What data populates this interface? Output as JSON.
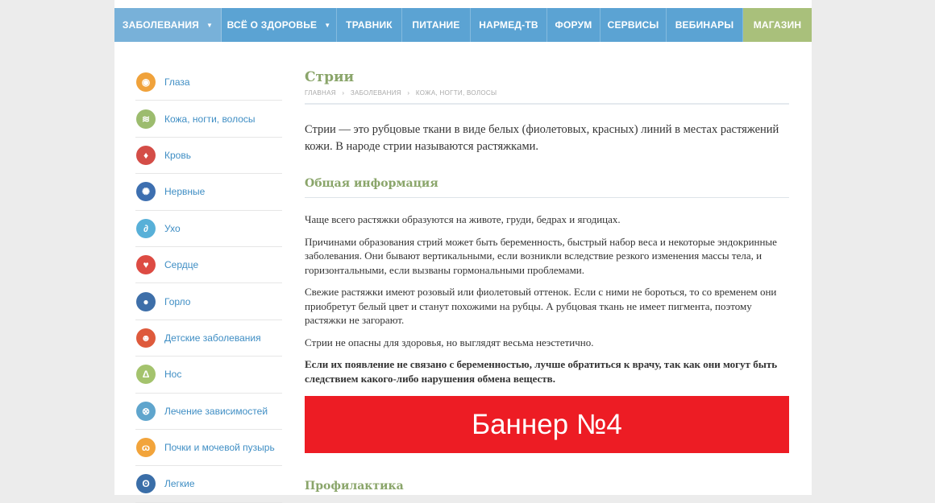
{
  "nav": {
    "items": [
      {
        "label": "ЗАБОЛЕВАНИЯ",
        "caret": "▼"
      },
      {
        "label": "ВСЁ О ЗДОРОВЬЕ",
        "caret": "▼"
      },
      {
        "label": "ТРАВНИК"
      },
      {
        "label": "ПИТАНИЕ"
      },
      {
        "label": "НАРМЕД-ТВ"
      },
      {
        "label": "ФОРУМ"
      },
      {
        "label": "СЕРВИСЫ"
      },
      {
        "label": "ВЕБИНАРЫ"
      },
      {
        "label": "МАГАЗИН"
      }
    ],
    "colors": {
      "bar": "#5ba3d3",
      "active": "#78b1d9",
      "shop": "#a9c07b"
    }
  },
  "sidebar": {
    "items": [
      {
        "label": "Глаза",
        "icon": "eye-icon",
        "color": "#f0a23b",
        "glyph": "◉"
      },
      {
        "label": "Кожа, ногти, волосы",
        "icon": "hair-icon",
        "color": "#9cbc6e",
        "glyph": "≋"
      },
      {
        "label": "Кровь",
        "icon": "blood-drops-icon",
        "color": "#d44d47",
        "glyph": "♦"
      },
      {
        "label": "Нервные",
        "icon": "neuron-icon",
        "color": "#3d6fb0",
        "glyph": "✺"
      },
      {
        "label": "Ухо",
        "icon": "ear-icon",
        "color": "#58b0d8",
        "glyph": "∂"
      },
      {
        "label": "Сердце",
        "icon": "heart-icon",
        "color": "#dd4b43",
        "glyph": "♥"
      },
      {
        "label": "Горло",
        "icon": "throat-icon",
        "color": "#3e6fa9",
        "glyph": "●"
      },
      {
        "label": "Детские заболевания",
        "icon": "child-icon",
        "color": "#de5a3c",
        "glyph": "☻"
      },
      {
        "label": "Нос",
        "icon": "nose-icon",
        "color": "#a4c36d",
        "glyph": "Δ"
      },
      {
        "label": "Лечение зависимостей",
        "icon": "addiction-icon",
        "color": "#5fa5cd",
        "glyph": "⊗"
      },
      {
        "label": "Почки и мочевой пузырь",
        "icon": "kidneys-icon",
        "color": "#f2a43b",
        "glyph": "ɷ"
      },
      {
        "label": "Легкие",
        "icon": "lungs-icon",
        "color": "#3a6ea8",
        "glyph": "ʘ"
      }
    ]
  },
  "article": {
    "title": "Стрии",
    "breadcrumbs": [
      "ГЛАВНАЯ",
      "ЗАБОЛЕВАНИЯ",
      "КОЖА, НОГТИ, ВОЛОСЫ"
    ],
    "breadcrumb_sep": "›",
    "lead": "Стрии — это рубцовые ткани в виде белых (фиолетовых, красных) линий в местах растяжений кожи. В народе стрии называются растяжками.",
    "section1_title": "Общая информация",
    "paragraphs": [
      "Чаще всего растяжки образуются на животе, груди, бедрах и ягодицах.",
      "Причинами образования стрий может быть беременность, быстрый набор веса и некоторые эндокринные заболевания. Они бывают вертикальными, если возникли вследствие резкого изменения массы тела, и горизонтальными, если вызваны гормональными проблемами.",
      "Свежие растяжки имеют розовый или фиолетовый оттенок. Если с ними не бороться, то со временем они приобретут белый цвет и станут похожими на рубцы. А рубцовая ткань не имеет пигмента, поэтому растяжки не загорают.",
      "Стрии не опасны для здоровья, но выглядят весьма неэстетично."
    ],
    "bold_paragraph": "Если их появление не связано с беременностью, лучше обратиться к врачу, так как они могут быть следствием какого-либо нарушения обмена веществ.",
    "banner": "Баннер №4",
    "section2_title": "Профилактика"
  }
}
